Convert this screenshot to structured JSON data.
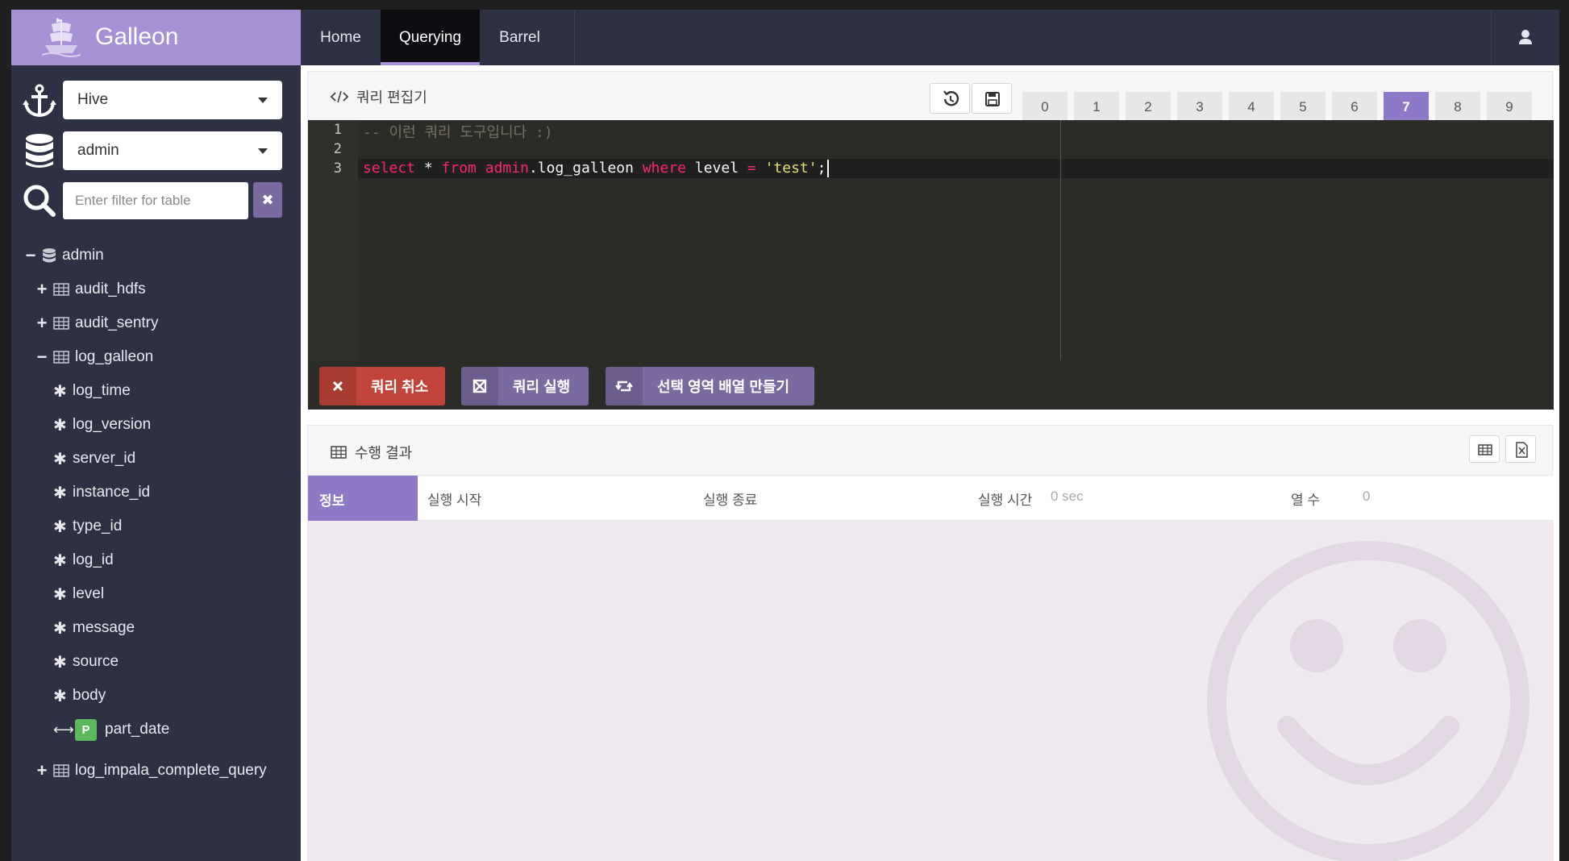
{
  "app": {
    "name": "Galleon"
  },
  "nav": {
    "tabs": [
      "Home",
      "Querying",
      "Barrel"
    ],
    "active": "Querying"
  },
  "sidebar": {
    "engine_select": "Hive",
    "database_select": "admin",
    "filter_placeholder": "Enter filter for table",
    "clear_label": "✖",
    "tree": {
      "database": "admin",
      "tables": [
        {
          "name": "audit_hdfs",
          "expanded": false
        },
        {
          "name": "audit_sentry",
          "expanded": false
        },
        {
          "name": "log_galleon",
          "expanded": true,
          "columns": [
            "log_time",
            "log_version",
            "server_id",
            "instance_id",
            "type_id",
            "log_id",
            "level",
            "message",
            "source",
            "body"
          ],
          "partition": {
            "badge": "P",
            "name": "part_date"
          }
        },
        {
          "name": "log_impala_complete_query",
          "expanded": false
        }
      ]
    }
  },
  "editor": {
    "title": "쿼리 편집기",
    "tabs": [
      "0",
      "1",
      "2",
      "3",
      "4",
      "5",
      "6",
      "7",
      "8",
      "9"
    ],
    "active_tab": "7",
    "line_numbers": [
      "1",
      "2",
      "3"
    ],
    "line1_comment": "-- 이런 쿼리 도구입니다 :)",
    "line3": {
      "select": "select",
      "star": " * ",
      "from": "from",
      "space1": " ",
      "schema": "admin",
      "table": ".log_galleon ",
      "where": "where",
      "col": " level ",
      "eq": "=",
      "space2": " ",
      "value": "'test'",
      "semi": ";"
    },
    "actions": {
      "cancel": "쿼리 취소",
      "run": "쿼리 실행",
      "array": "선택 영역 배열 만들기"
    }
  },
  "result": {
    "title": "수행 결과",
    "info_label": "정보",
    "start_label": "실행 시작",
    "end_label": "실행 종료",
    "duration_label": "실행 시간",
    "duration_value": "0 sec",
    "columns_label": "열 수",
    "columns_value": "0"
  },
  "colors": {
    "accent": "#a691d6",
    "accent_dark": "#8e79c6",
    "sidebar": "#2d3143",
    "danger": "#c0443a",
    "partition_badge": "#5cb85c"
  }
}
